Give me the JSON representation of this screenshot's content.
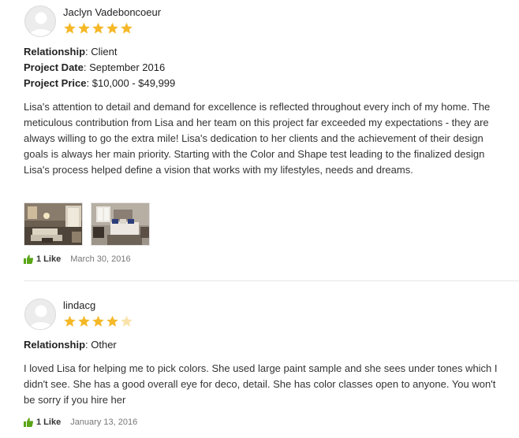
{
  "reviews": [
    {
      "name": "Jaclyn Vadeboncoeur",
      "rating": 5,
      "rating_max": 5,
      "details": [
        {
          "label": "Relationship",
          "value": "Client"
        },
        {
          "label": "Project Date",
          "value": "September 2016"
        },
        {
          "label": "Project Price",
          "value": "$10,000 - $49,999"
        }
      ],
      "text": "Lisa's attention to detail and demand for excellence is reflected throughout every inch of my home. The meticulous contribution from Lisa and her team on this project far exceeded my expectations - they are always willing to go the extra mile! Lisa's dedication to her clients and the achievement of their design goals is always her main priority. Starting with the Color and Shape test leading to the finalized design Lisa's process helped define a vision that works with my lifestyles, needs and dreams.",
      "photos": [
        "living-room-photo",
        "bedroom-photo"
      ],
      "likes": "1 Like",
      "date": "March 30, 2016"
    },
    {
      "name": "lindacg",
      "rating": 4,
      "rating_max": 5,
      "details": [
        {
          "label": "Relationship",
          "value": "Other"
        }
      ],
      "text": "I loved Lisa for helping me to pick colors. She used large paint sample and she sees under tones which I didn't see. She has a good overall eye for deco, detail. She has color classes open to anyone. You won't be sorry if you hire her",
      "likes": "1 Like",
      "date": "January 13, 2016"
    }
  ],
  "colors": {
    "star_filled": "#f5b828",
    "star_empty": "#f9e3aa",
    "like_green": "#5aa618"
  }
}
